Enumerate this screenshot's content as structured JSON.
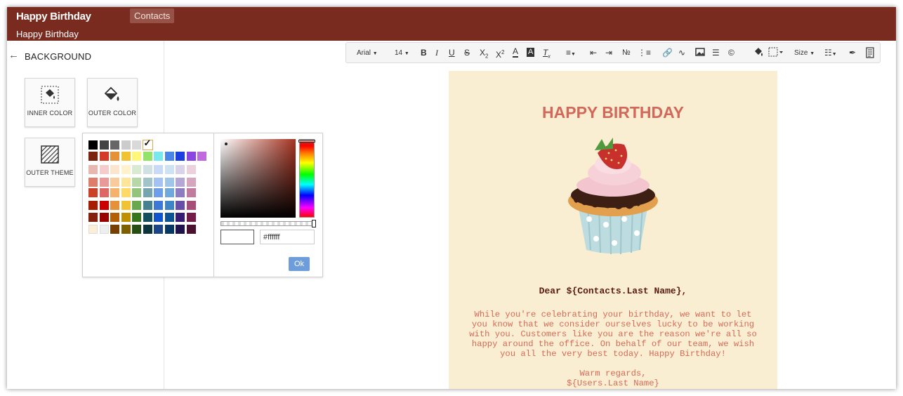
{
  "header": {
    "app_title": "Happy Birthday",
    "module_button": "Contacts",
    "sub_title": "Happy Birthday",
    "brand_color": "#7a2b1f"
  },
  "sidebar": {
    "back_icon": "arrow-left-icon",
    "section_title": "BACKGROUND",
    "tiles": [
      {
        "label": "INNER COLOR",
        "icon": "paint-bucket-inner-icon"
      },
      {
        "label": "OUTER COLOR",
        "icon": "paint-bucket-outer-icon"
      },
      {
        "label": "OUTER THEME",
        "icon": "hatched-pattern-icon"
      }
    ]
  },
  "color_picker": {
    "hex_value": "#ffffff",
    "ok_label": "Ok",
    "swatch_rows": [
      [
        "#000000",
        "#434343",
        "#666666",
        "#cccccc",
        "#d9d9d9",
        "#ffffff"
      ],
      [
        "#7a2410",
        "#d53a28",
        "#e69138",
        "#f1c232",
        "#fff67a",
        "#93e26a",
        "#76e8ee",
        "#4a86e8",
        "#1c3fe0",
        "#8b45e0",
        "#c06ae0"
      ],
      [
        "#e6b8af",
        "#f4cccc",
        "#fce5cd",
        "#fff2cc",
        "#d9ead3",
        "#d0e0e3",
        "#c9daf8",
        "#cfe2f3",
        "#d9d2e9",
        "#ead1dc"
      ],
      [
        "#dd7e6b",
        "#ea9999",
        "#f9cb9c",
        "#ffe599",
        "#b6d7a8",
        "#a2c4c9",
        "#a4c2f4",
        "#9fc5e8",
        "#b4a7d6",
        "#d5a6bd"
      ],
      [
        "#cc4125",
        "#e06666",
        "#f6b26b",
        "#ffd966",
        "#93c47d",
        "#76a5af",
        "#6d9eeb",
        "#6fa8dc",
        "#8e7cc3",
        "#c27ba0"
      ],
      [
        "#a61c00",
        "#cc0000",
        "#e69138",
        "#f1c232",
        "#6aa84f",
        "#45818e",
        "#3c78d8",
        "#3d85c6",
        "#674ea7",
        "#a64d79"
      ],
      [
        "#85200c",
        "#990000",
        "#b45f06",
        "#bf9000",
        "#38761d",
        "#134f5c",
        "#1155cc",
        "#0b5394",
        "#351c75",
        "#741b47"
      ],
      [
        "#5b0f00",
        "#660000",
        "#783f04",
        "#7f6000",
        "#274e13",
        "#0c343d",
        "#1c4587",
        "#073763",
        "#20124d",
        "#4c1130"
      ],
      [
        "#fbf0d6",
        "#eeeeee"
      ]
    ],
    "selected_swatch": "#ffffff"
  },
  "toolbar": {
    "font_family": "Arial",
    "font_size": "14",
    "size_label": "Size",
    "icons": [
      "bold-icon",
      "italic-icon",
      "underline-icon",
      "strikethrough-icon",
      "subscript-icon",
      "superscript-icon",
      "font-color-icon",
      "background-color-icon",
      "clear-format-icon",
      "align-icon",
      "outdent-icon",
      "indent-icon",
      "ordered-list-icon",
      "unordered-list-icon",
      "link-icon",
      "unlink-icon",
      "image-icon",
      "horizontal-rule-icon",
      "copyright-icon",
      "fill-color-icon",
      "border-icon",
      "table-icon",
      "brush-icon",
      "source-icon"
    ]
  },
  "email": {
    "background": "#faeed2",
    "title": "HAPPY BIRTHDAY",
    "image_icon": "cupcake-icon",
    "greeting": "Dear ${Contacts.Last Name},",
    "body_lines": [
      "While you're celebrating your birthday, we want to let",
      "you know that we consider ourselves lucky to be working",
      "with you. Customers like you are the reason we're all so",
      "happy around the office. On behalf of our team, we wish",
      "you all the very best today. Happy Birthday!"
    ],
    "closing": "Warm regards,",
    "signature": "${Users.Last Name}"
  }
}
